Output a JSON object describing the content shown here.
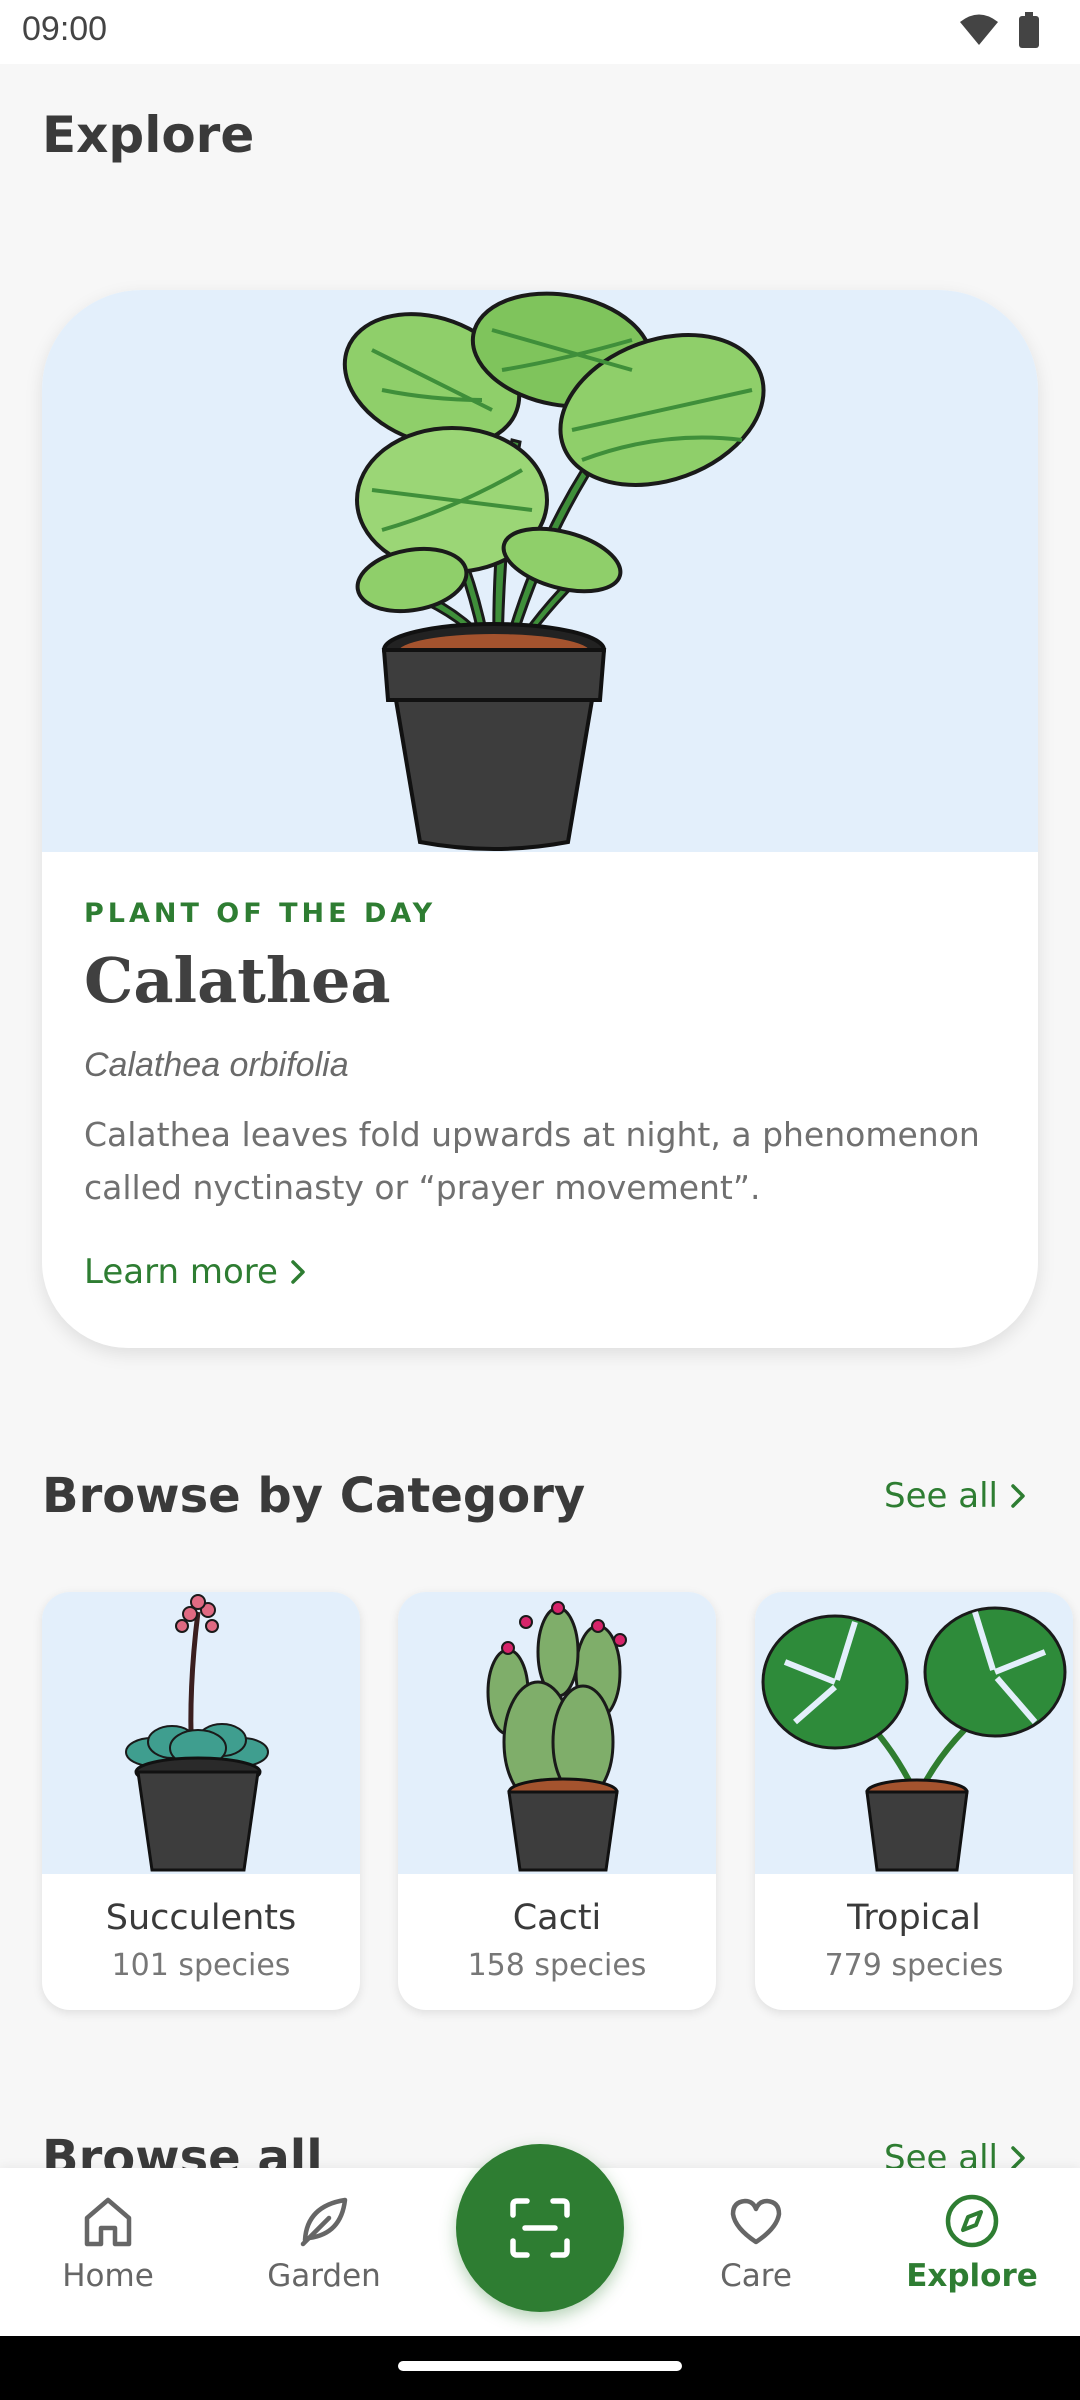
{
  "status_bar": {
    "time": "09:00",
    "icons": [
      "wifi-icon",
      "battery-icon"
    ]
  },
  "page_title": "Explore",
  "plant_of_day": {
    "label": "PLANT OF THE DAY",
    "name": "Calathea",
    "scientific_name": "Calathea orbifolia",
    "description": "Calathea leaves fold upwards at night, a phenomenon called nyctinasty or “prayer movement”.",
    "link_label": "Learn more"
  },
  "categories_section": {
    "title": "Browse by Category",
    "see_all_label": "See all",
    "items": [
      {
        "name": "Succulents",
        "count": "101 species"
      },
      {
        "name": "Cacti",
        "count": "158 species"
      },
      {
        "name": "Tropical",
        "count": "779 species"
      }
    ]
  },
  "browse_all_section": {
    "title": "Browse all",
    "see_all_label": "See all"
  },
  "bottom_nav": {
    "items": [
      {
        "label": "Home",
        "icon": "home-icon"
      },
      {
        "label": "Garden",
        "icon": "leaf-icon"
      },
      {
        "label": "Care",
        "icon": "heart-icon"
      },
      {
        "label": "Explore",
        "icon": "compass-icon"
      }
    ],
    "active": "Explore",
    "fab_icon": "scan-icon"
  },
  "colors": {
    "accent": "#2e7d32",
    "image_bg": "#e3effb",
    "page_bg": "#f7f7f7"
  }
}
